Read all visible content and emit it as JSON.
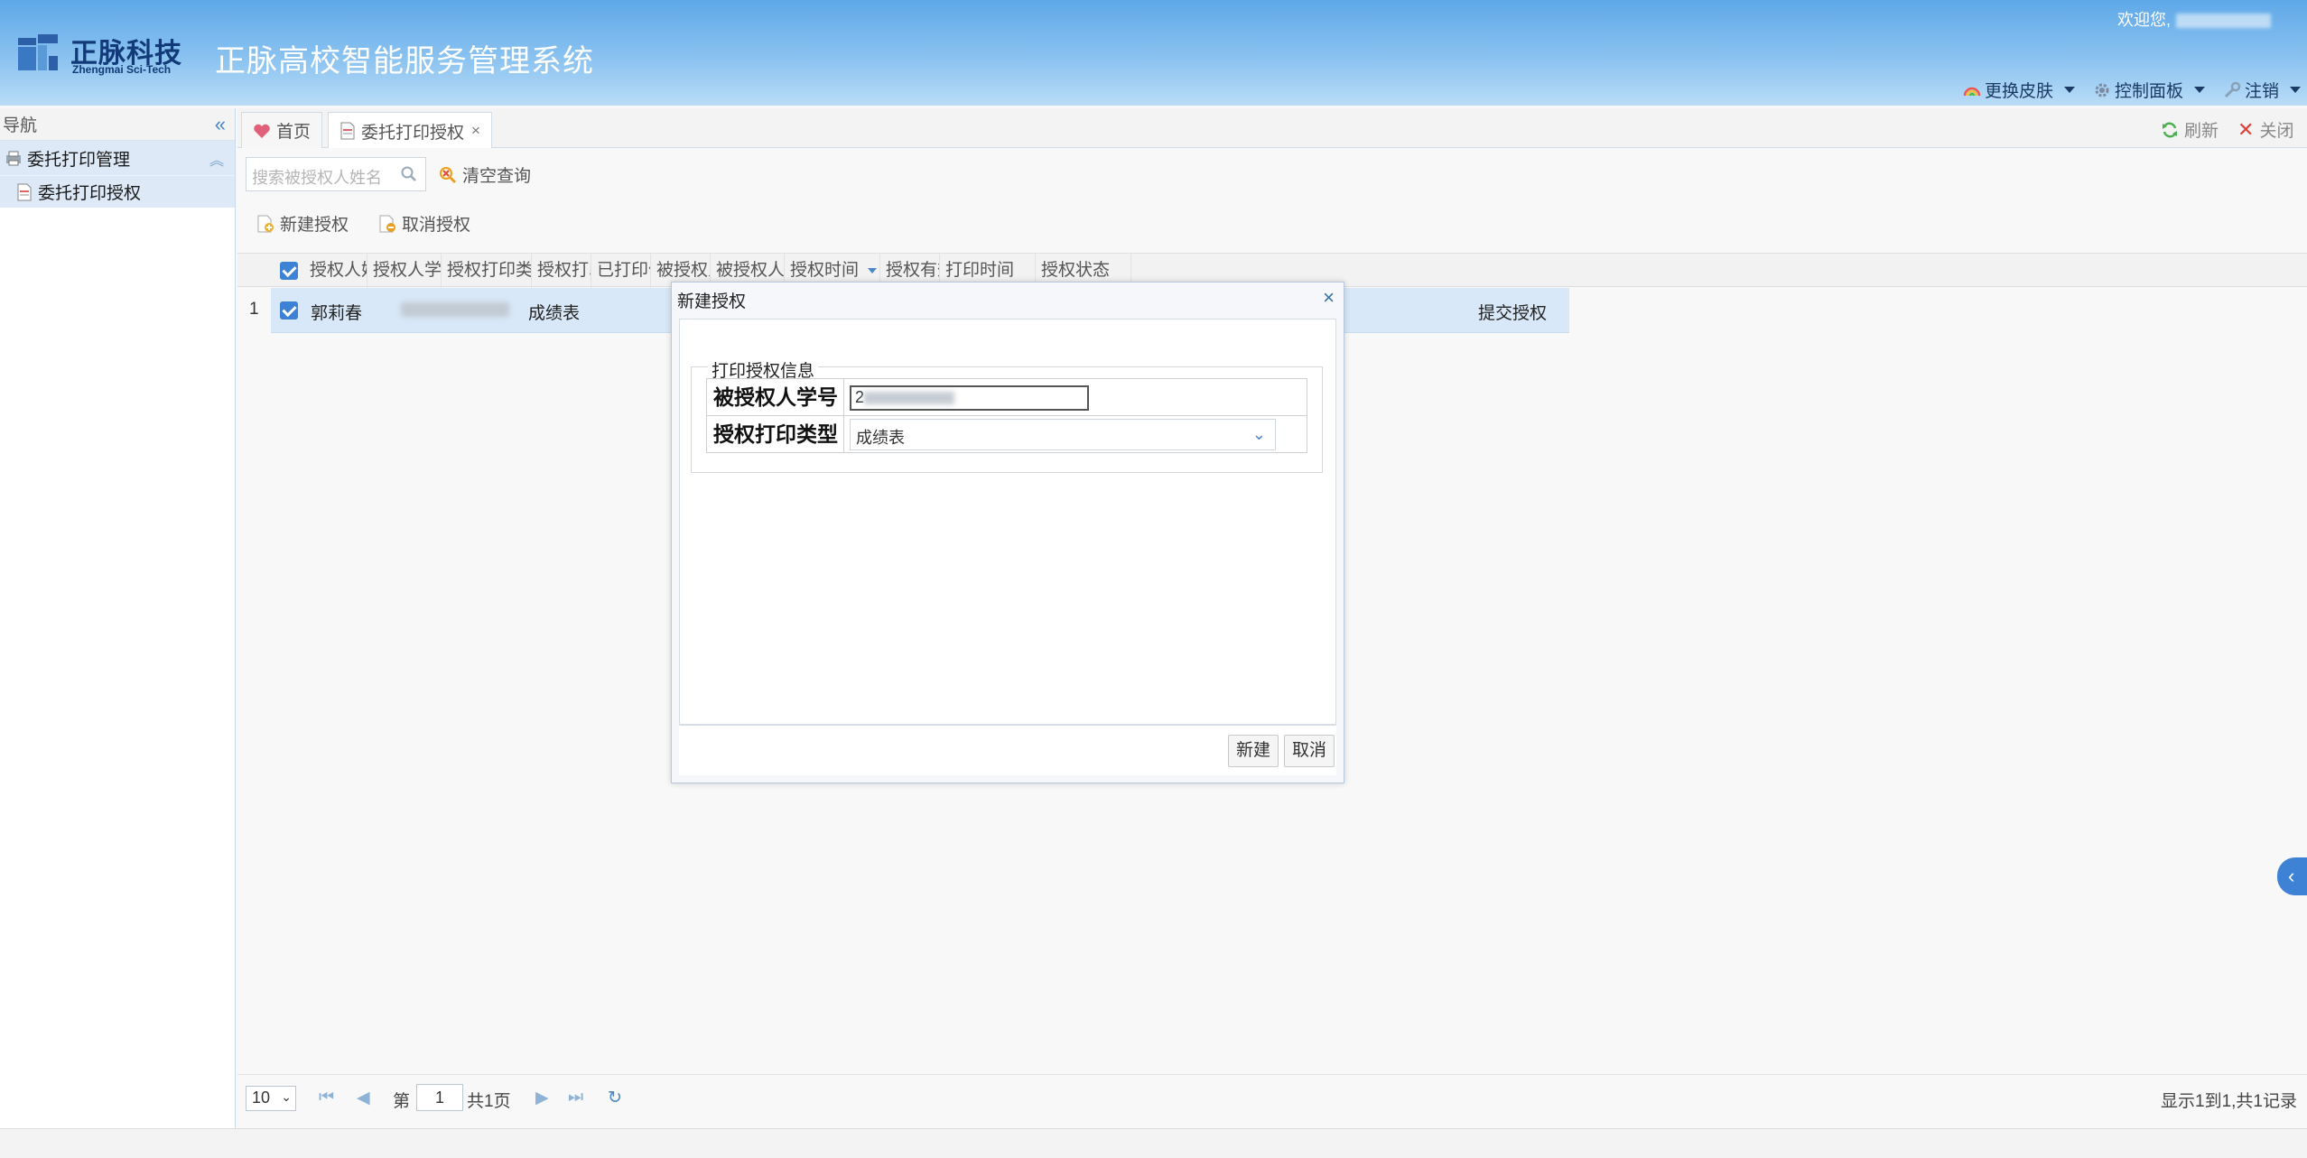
{
  "header": {
    "logo_cn": "正脉科技",
    "logo_en": "Zhengmai Sci-Tech",
    "system_title": "正脉高校智能服务管理系统",
    "welcome": "欢迎您,",
    "menu_skin": "更换皮肤",
    "menu_control": "控制面板",
    "menu_logout": "注销"
  },
  "nav": {
    "title": "导航",
    "group_label": "委托打印管理",
    "item_label": "委托打印授权"
  },
  "tabs": {
    "home": "首页",
    "current": "委托打印授权",
    "refresh": "刷新",
    "close": "关闭"
  },
  "toolbar": {
    "search_placeholder": "搜索被授权人姓名",
    "clear_query": "清空查询",
    "new_auth": "新建授权",
    "cancel_auth": "取消授权"
  },
  "grid": {
    "columns": [
      "授权人姓名",
      "授权人学号",
      "授权打印类型",
      "授权打印份数",
      "已打印份数",
      "被授权人姓名",
      "被授权人学号",
      "授权时间",
      "授权有效期",
      "打印时间",
      "授权状态"
    ],
    "rows": [
      {
        "num": "1",
        "name": "郭莉春",
        "type": "成绩表",
        "status": "提交授权"
      }
    ]
  },
  "pager": {
    "page_size": "10",
    "page_prefix": "第",
    "page_num": "1",
    "page_total": "共1页",
    "summary": "显示1到1,共1记录"
  },
  "modal": {
    "title": "新建授权",
    "legend": "打印授权信息",
    "field1_label": "被授权人学号",
    "field1_value": "2",
    "field2_label": "授权打印类型",
    "field2_value": "成绩表",
    "btn_create": "新建",
    "btn_cancel": "取消"
  },
  "colors": {
    "accent": "#3d82d4",
    "header_top": "#5ea8e8",
    "selected_row": "#d8e8f8"
  }
}
